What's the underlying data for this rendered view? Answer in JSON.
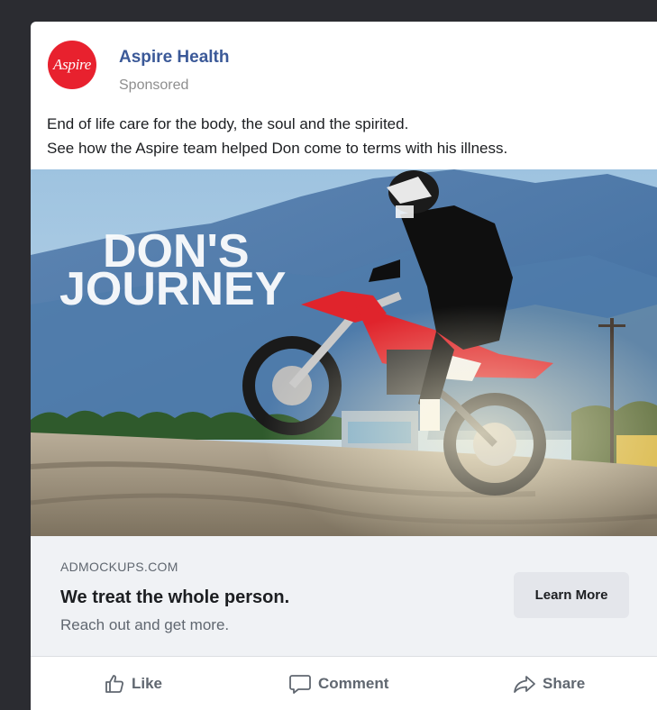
{
  "post": {
    "avatar_text": "Aspire",
    "page_name": "Aspire Health",
    "sponsored": "Sponsored",
    "body_line1": "End of life care for the body, the soul and the spirited.",
    "body_line2": "See how the Aspire team helped Don come to terms with his illness."
  },
  "media": {
    "overlay_line1": "DON'S",
    "overlay_line2": "JOURNEY"
  },
  "link_preview": {
    "domain": "ADMOCKUPS.COM",
    "headline": "We treat the whole person.",
    "description": "Reach out and get more.",
    "cta_label": "Learn More"
  },
  "actions": {
    "like_label": "Like",
    "comment_label": "Comment",
    "share_label": "Share"
  },
  "colors": {
    "brand_red": "#e8212e",
    "page_link": "#3b5998",
    "preview_bg": "#f0f2f5",
    "button_bg": "#e4e6eb"
  }
}
